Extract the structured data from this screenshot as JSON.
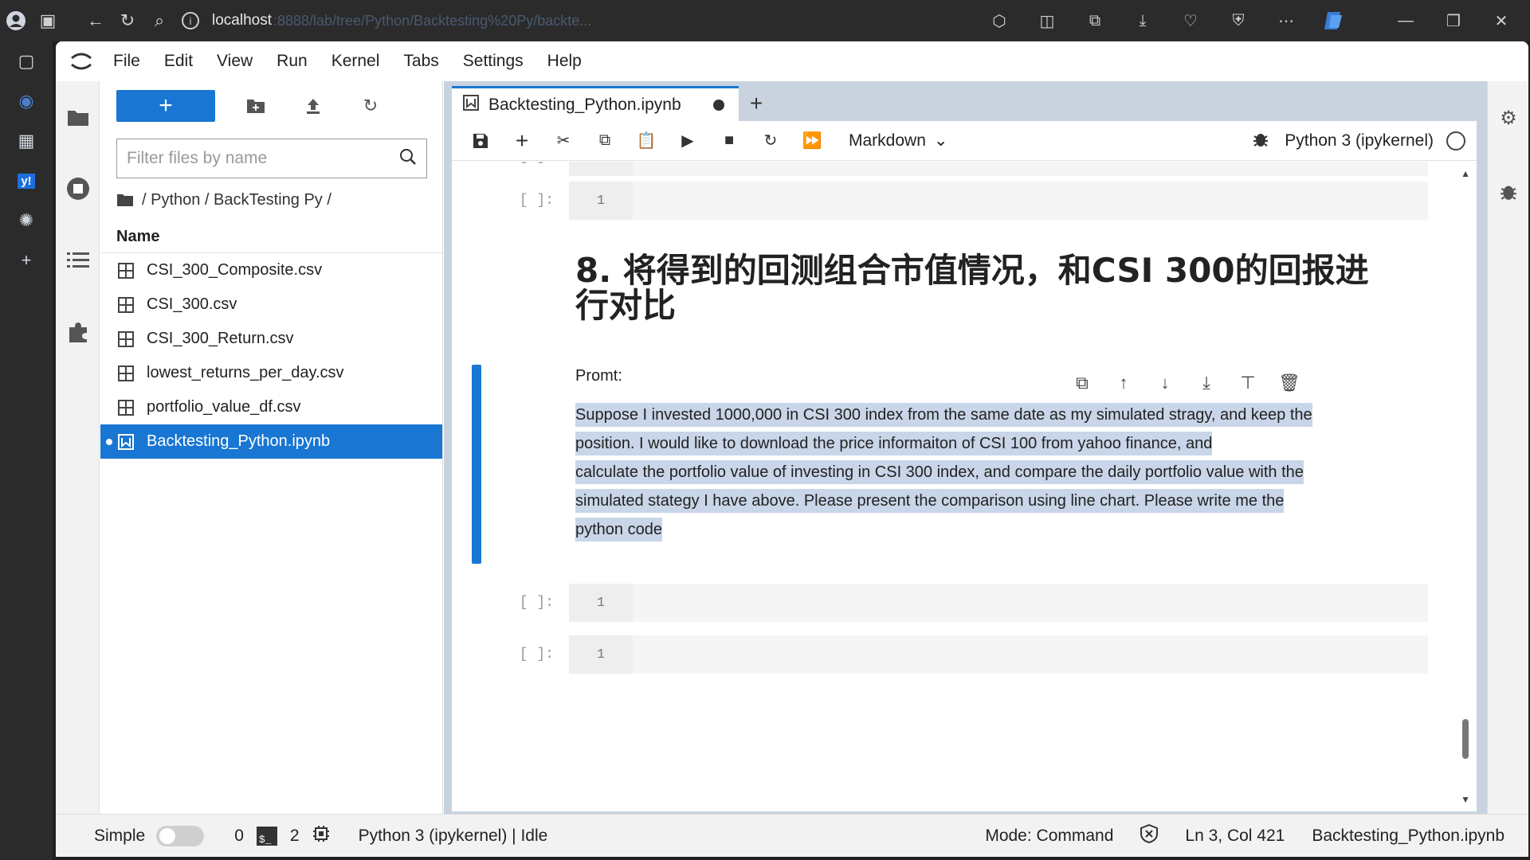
{
  "browser": {
    "address_host": "localhost",
    "address_path": ":8888/lab/tree/Python/Backtesting%20Py/backte..."
  },
  "menu": [
    "File",
    "Edit",
    "View",
    "Run",
    "Kernel",
    "Tabs",
    "Settings",
    "Help"
  ],
  "filebrowser": {
    "new_label": "+",
    "filter_placeholder": "Filter files by name",
    "breadcrumb": "/ Python / BackTesting Py /",
    "name_header": "Name",
    "files": [
      {
        "name": "CSI_300_Composite.csv",
        "icon": "table-icon"
      },
      {
        "name": "CSI_300.csv",
        "icon": "table-icon"
      },
      {
        "name": "CSI_300_Return.csv",
        "icon": "table-icon"
      },
      {
        "name": "lowest_returns_per_day.csv",
        "icon": "table-icon"
      },
      {
        "name": "portfolio_value_df.csv",
        "icon": "table-icon"
      },
      {
        "name": "Backtesting_Python.ipynb",
        "icon": "notebook-icon"
      }
    ]
  },
  "notebook": {
    "tab_title": "Backtesting_Python.ipynb",
    "cell_type": "Markdown",
    "kernel_name": "Python 3 (ipykernel)",
    "cell_prompt": "[ ]:",
    "line_number": "1",
    "heading": "8. 将得到的回测组合市值情况，和CSI 300的回报进行对比",
    "promt_label": "Promt:",
    "paragraph_lines": [
      "Suppose I invested 1000,000 in CSI 300 index from the same date as my simulated stragy, and keep the",
      "position. I would like to download the price informaiton of CSI 100 from yahoo finance, and",
      "calculate the portfolio value of investing in CSI 300 index, and compare the daily portfolio value with the",
      "simulated stategy I have above. Please present the comparison using line chart. Please write me the",
      "python code"
    ]
  },
  "statusbar": {
    "simple_label": "Simple",
    "count_a": "0",
    "count_b": "2",
    "kernel_status": "Python 3 (ipykernel) | Idle",
    "mode": "Mode: Command",
    "cursor": "Ln 3, Col 421",
    "filename": "Backtesting_Python.ipynb"
  },
  "colors": {
    "accent": "#1976d2",
    "selection": "#c9d5e8"
  }
}
